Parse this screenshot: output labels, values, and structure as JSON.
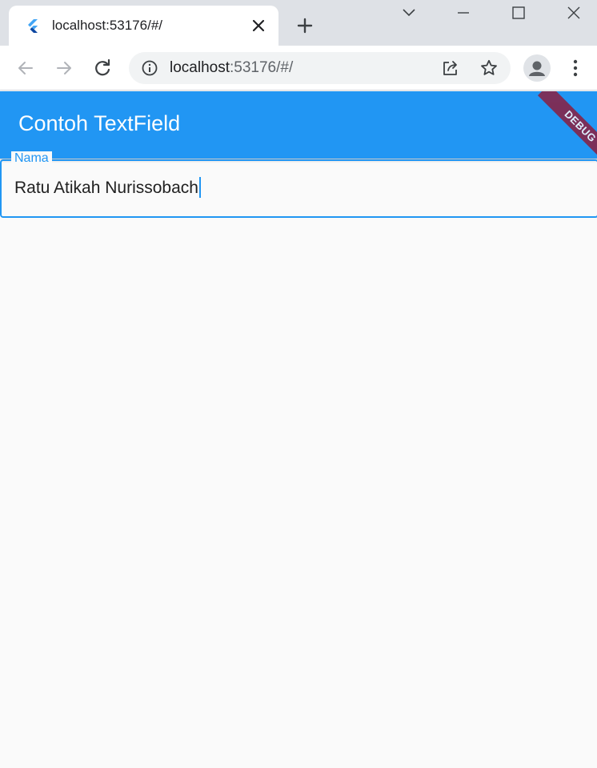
{
  "browser": {
    "tab": {
      "title": "localhost:53176/#/",
      "favicon": "flutter-logo"
    },
    "address": {
      "host": "localhost",
      "port_path": ":53176/#/"
    },
    "icons": [
      "back-icon",
      "forward-icon",
      "reload-icon",
      "info-icon",
      "share-icon",
      "star-icon",
      "profile-icon",
      "menu-icon"
    ]
  },
  "app": {
    "title": "Contoh TextField",
    "debug_banner": "DEBUG",
    "textfield": {
      "label": "Nama",
      "value": "Ratu Atikah Nurissobach"
    }
  },
  "colors": {
    "primary": "#2196f3",
    "background": "#fafafa",
    "debug_banner": "#8b1e3f"
  }
}
